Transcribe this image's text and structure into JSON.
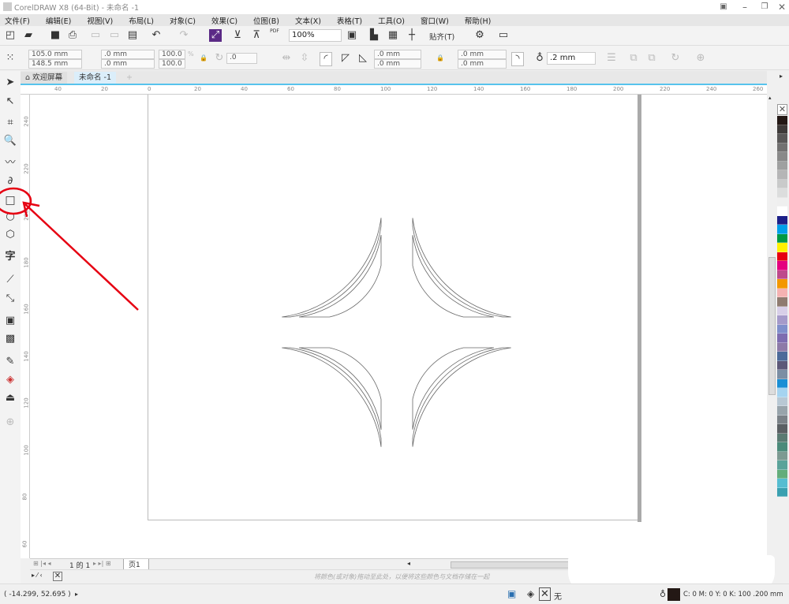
{
  "window": {
    "title": "CorelDRAW X8 (64-Bit) - 未命名 -1"
  },
  "menu": [
    "文件(F)",
    "编辑(E)",
    "视图(V)",
    "布局(L)",
    "对象(C)",
    "效果(C)",
    "位图(B)",
    "文本(X)",
    "表格(T)",
    "工具(O)",
    "窗口(W)",
    "帮助(H)"
  ],
  "toolbar": {
    "zoom": "100%",
    "snap": "贴齐(T)",
    "pdf": "PDF"
  },
  "propbar": {
    "x": "105.0 mm",
    "y": "148.5 mm",
    "w": ".0 mm",
    "h": ".0 mm",
    "sx": "100.0",
    "sy": "100.0",
    "pct": "%",
    "angle": ".0",
    "corner1": ".0 mm",
    "corner2": ".0 mm",
    "corner3": ".0 mm",
    "corner4": ".0 mm",
    "outline": ".2 mm"
  },
  "tabs": {
    "welcome": "欢迎屏幕",
    "doc": "未命名 -1"
  },
  "hruler": [
    "40",
    "20",
    "0",
    "20",
    "40",
    "60",
    "80",
    "100",
    "120",
    "140",
    "160",
    "180",
    "200",
    "220",
    "240",
    "260"
  ],
  "vruler": [
    "240",
    "220",
    "200",
    "180",
    "160",
    "140",
    "120",
    "100",
    "80",
    "60"
  ],
  "pagenav": {
    "text": "1 的 1",
    "page_tab": "页1"
  },
  "docpal": {
    "hint": "将颜色(或对象)拖动至此处，以便将这些颜色与文档存储在一起"
  },
  "status": {
    "coords": "( -14.299, 52.695 )",
    "fill": "无",
    "outline": "C: 0 M: 0 Y: 0 K: 100  .200 mm"
  },
  "palette": [
    "#231815",
    "#3e3a39",
    "#595757",
    "#727171",
    "#898989",
    "#9fa0a0",
    "#b5b5b6",
    "#c9caca",
    "#dcdddd",
    "#efefef",
    "#ffffff",
    "#1d2088",
    "#00a0e9",
    "#009944",
    "#fff100",
    "#e60012",
    "#e4007f",
    "#be4a8c",
    "#f39800",
    "#f5b2b2",
    "#8f7b70",
    "#d8cfe8",
    "#a59aca",
    "#7f8fcb",
    "#7d6db0",
    "#8d7aa8",
    "#4c6a9a",
    "#5d5879",
    "#7b8ea4",
    "#1a8fd5",
    "#a6d4f0",
    "#b8c8d4",
    "#98a4ab",
    "#7a8187",
    "#5a5f63",
    "#5a7a72",
    "#4b8a7a",
    "#7d9a92",
    "#5aa39a",
    "#64ad7b",
    "#56bdd1",
    "#3aa0b0"
  ],
  "colors": {
    "accent": "#57c3ec",
    "annotation": "#e60012"
  }
}
